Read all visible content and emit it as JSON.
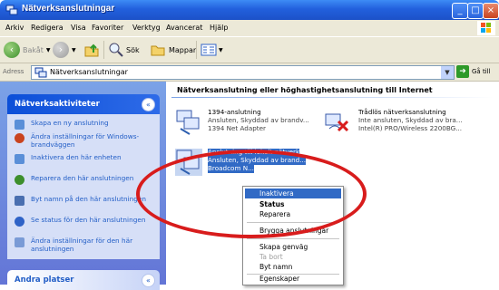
{
  "window": {
    "title": "Nätverksanslutningar"
  },
  "menu": [
    "Arkiv",
    "Redigera",
    "Visa",
    "Favoriter",
    "Verktyg",
    "Avancerat",
    "Hjälp"
  ],
  "toolbar": {
    "back": "Bakåt",
    "search": "Sök",
    "folders": "Mappar"
  },
  "address": {
    "label": "Adress",
    "value": "Nätverksanslutningar",
    "go": "Gå till"
  },
  "sidebar": {
    "network_tasks_title": "Nätverksaktiviteter",
    "tasks": [
      "Skapa en ny anslutning",
      "Ändra inställningar för Windows-brandväggen",
      "Inaktivera den här enheten",
      "Reparera den här anslutningen",
      "Byt namn på den här anslutningen",
      "Se status för den här anslutningen",
      "Ändra inställningar för den här anslutningen"
    ],
    "other_places_title": "Andra platser"
  },
  "content": {
    "group_title": "Nätverksanslutning eller höghastighetsanslutning till Internet",
    "connections": [
      {
        "name": "1394-anslutning",
        "status": "Ansluten, Skyddad av brandv...",
        "device": "1394 Net Adapter"
      },
      {
        "name": "Trådlös nätverksanslutning",
        "status": "Inte ansluten, Skyddad av bra...",
        "device": "Intel(R) PRO/Wireless 2200BG..."
      },
      {
        "name": "Anslutning till lokalt nätverk",
        "status": "Ansluten, Skyddad av brand...",
        "device": "Broadcom N..."
      }
    ]
  },
  "context_menu": {
    "items": [
      "Inaktivera",
      "Status",
      "Reparera",
      "Brygga anslutningar",
      "Skapa genväg",
      "Ta bort",
      "Byt namn",
      "Egenskaper"
    ]
  },
  "colors": {
    "titlebar": "#2260dd",
    "highlight": "#316ac5",
    "annotation": "#d81c1c"
  }
}
